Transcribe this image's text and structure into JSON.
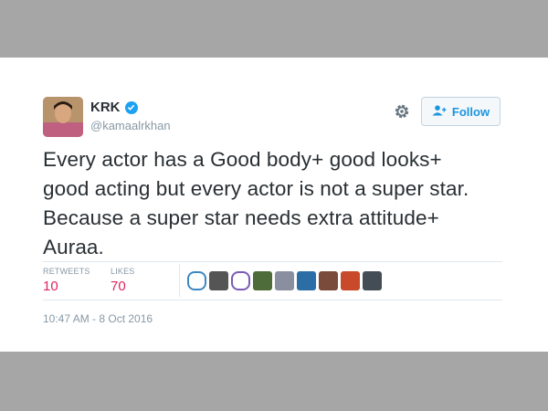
{
  "tweet": {
    "display_name": "KRK",
    "handle": "@kamaalrkhan",
    "verified": true,
    "follow_label": "Follow",
    "text_lines": [
      "Every actor has a Good body+ good looks+",
      "good acting but every actor is not a super star.",
      "Because a super star needs extra attitude+",
      "Auraa."
    ],
    "stats": {
      "retweets_label": "RETWEETS",
      "retweets_value": "10",
      "likes_label": "LIKES",
      "likes_value": "70"
    },
    "liker_colors": [
      "#3b88c3",
      "#555555",
      "#7b5bb5",
      "#4e6b3a",
      "#8a8fa0",
      "#2b6ea6",
      "#7a4a3a",
      "#c84a2a",
      "#444c55"
    ],
    "timestamp": "10:47 AM - 8 Oct 2016"
  },
  "colors": {
    "accent": "#1da1f2",
    "likes": "#e0245e",
    "text": "#292f33",
    "muted": "#8899a6"
  },
  "icons": [
    "verified-badge-icon",
    "gear-icon",
    "add-user-icon"
  ]
}
